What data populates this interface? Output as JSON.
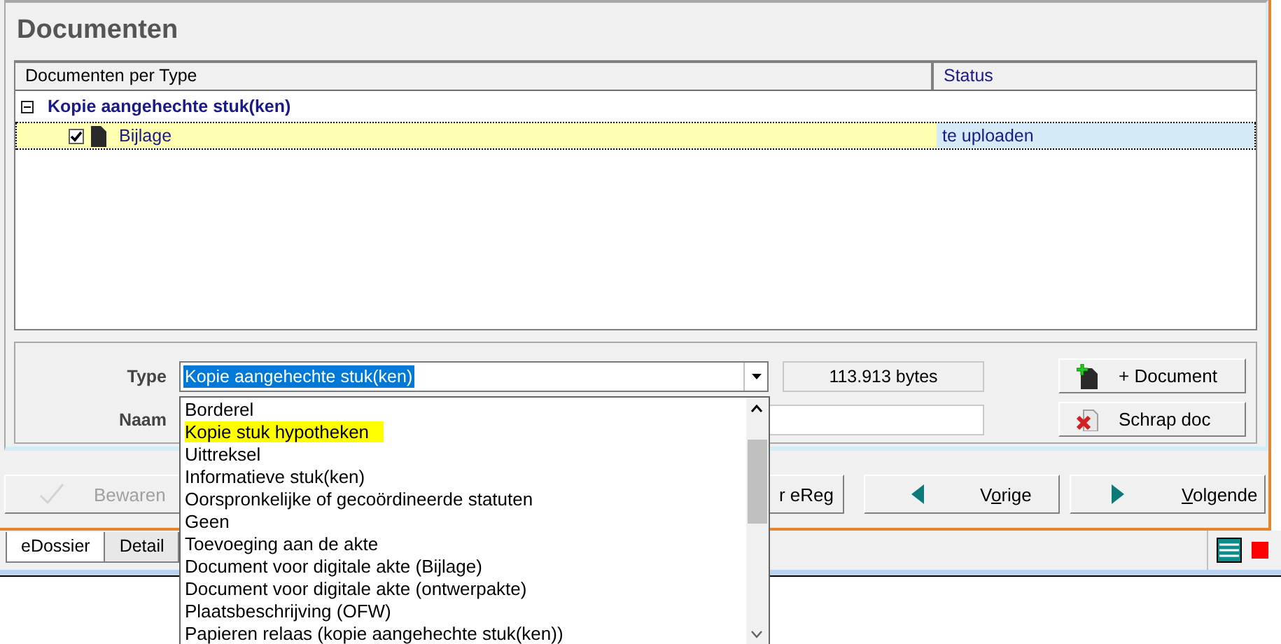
{
  "title": "Documenten",
  "table": {
    "columns": [
      "Documenten per Type",
      "Status"
    ],
    "groups": [
      {
        "label": "Kopie aangehechte stuk(ken)",
        "expanded": true,
        "children": [
          {
            "label": "Bijlage",
            "checked": true,
            "selected": true,
            "status": "te uploaden"
          }
        ]
      }
    ]
  },
  "form": {
    "type_label": "Type",
    "type_value": "Kopie aangehechte stuk(ken)",
    "size": "113.913 bytes",
    "name_label": "Naam"
  },
  "side_buttons": [
    {
      "kind": "add",
      "label": "+  Document"
    },
    {
      "kind": "delete",
      "label": "Schrap doc"
    }
  ],
  "dropdown": {
    "options": [
      {
        "label": "Borderel",
        "selected": false
      },
      {
        "label": "Kopie stuk hypotheken",
        "selected": true
      },
      {
        "label": "Uittreksel",
        "selected": false
      },
      {
        "label": "Informatieve stuk(ken)",
        "selected": false
      },
      {
        "label": "Oorspronkelijke of gecoördineerde statuten",
        "selected": false
      },
      {
        "label": "Geen",
        "selected": false
      },
      {
        "label": "Toevoeging aan de akte",
        "selected": false
      },
      {
        "label": "Document voor digitale akte (Bijlage)",
        "selected": false
      },
      {
        "label": "Document voor digitale akte (ontwerpakte)",
        "selected": false
      },
      {
        "label": "Plaatsbeschrijving (OFW)",
        "selected": false
      },
      {
        "label": "Papieren relaas (kopie aangehechte stuk(ken))",
        "selected": false
      }
    ]
  },
  "actions": [
    {
      "kind": "save",
      "label_after": "Bewaren",
      "disabled": true
    },
    {
      "kind": "plain",
      "label_after": "r eReg",
      "disabled": false
    },
    {
      "kind": "prev",
      "label_before": "V",
      "access_key": "o",
      "label_after": "rige",
      "disabled": false
    },
    {
      "kind": "next",
      "access_key": "V",
      "label_after": "olgende",
      "disabled": false
    }
  ],
  "tabs": [
    {
      "label": "eDossier",
      "selected": true
    },
    {
      "label": "Detail",
      "selected": false
    }
  ]
}
